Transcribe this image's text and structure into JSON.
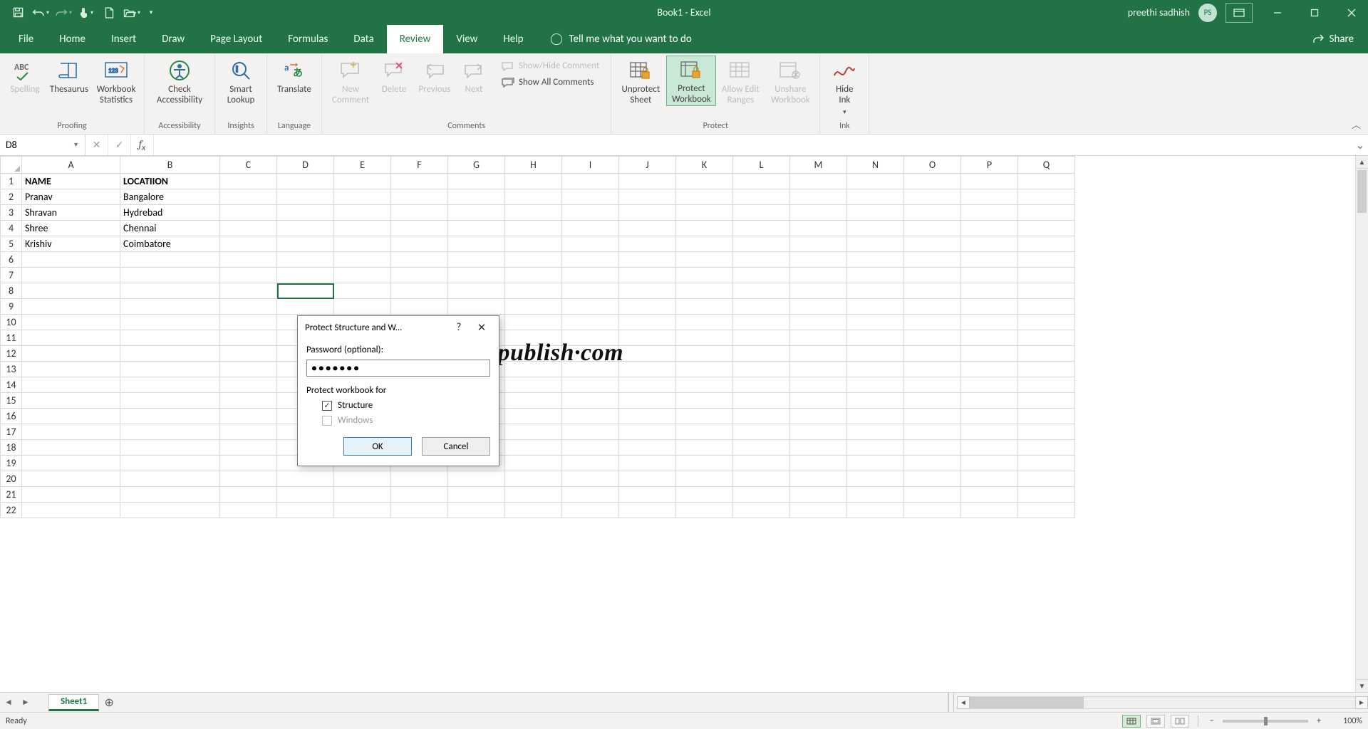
{
  "title": "Book1  -  Excel",
  "user": {
    "name": "preethi sadhish",
    "initials": "PS"
  },
  "tabs": [
    "File",
    "Home",
    "Insert",
    "Draw",
    "Page Layout",
    "Formulas",
    "Data",
    "Review",
    "View",
    "Help"
  ],
  "activeTab": "Review",
  "tellMe": "Tell me what you want to do",
  "share": "Share",
  "ribbon": {
    "groups": {
      "proofing": {
        "label": "Proofing",
        "spelling": "Spelling",
        "thesaurus": "Thesaurus",
        "statistics": "Workbook\nStatistics"
      },
      "accessibility": {
        "label": "Accessibility",
        "check": "Check\nAccessibility"
      },
      "insights": {
        "label": "Insights",
        "lookup": "Smart\nLookup"
      },
      "language": {
        "label": "Language",
        "translate": "Translate"
      },
      "comments": {
        "label": "Comments",
        "new": "New\nComment",
        "delete": "Delete",
        "previous": "Previous",
        "next": "Next",
        "showhide": "Show/Hide Comment",
        "showall": "Show All Comments"
      },
      "protect": {
        "label": "Protect",
        "unprotect": "Unprotect\nSheet",
        "workbook": "Protect\nWorkbook",
        "ranges": "Allow Edit\nRanges",
        "unshare": "Unshare\nWorkbook"
      },
      "ink": {
        "label": "Ink",
        "hide": "Hide\nInk"
      }
    }
  },
  "nameBox": "D8",
  "columns": [
    "A",
    "B",
    "C",
    "D",
    "E",
    "F",
    "G",
    "H",
    "I",
    "J",
    "K",
    "L",
    "M",
    "N",
    "O",
    "P",
    "Q"
  ],
  "rowCount": 22,
  "cells": {
    "A1": "NAME",
    "B1": "LOCATIION",
    "A2": "Pranav",
    "B2": "Bangalore",
    "A3": "Shravan",
    "B3": "Hydrebad",
    "A4": "Shree",
    "B4": "Chennai",
    "A5": "Krishiv",
    "B5": "Coimbatore"
  },
  "selectedCell": "D8",
  "watermark": "developerpublish·com",
  "dialog": {
    "title": "Protect Structure and W...",
    "passwordLabel": "Password (optional):",
    "passwordMask": "●●●●●●●",
    "sectionLabel": "Protect workbook for",
    "structure": "Structure",
    "windows": "Windows",
    "ok": "OK",
    "cancel": "Cancel"
  },
  "sheetTab": "Sheet1",
  "status": {
    "ready": "Ready",
    "zoom": "100%"
  }
}
